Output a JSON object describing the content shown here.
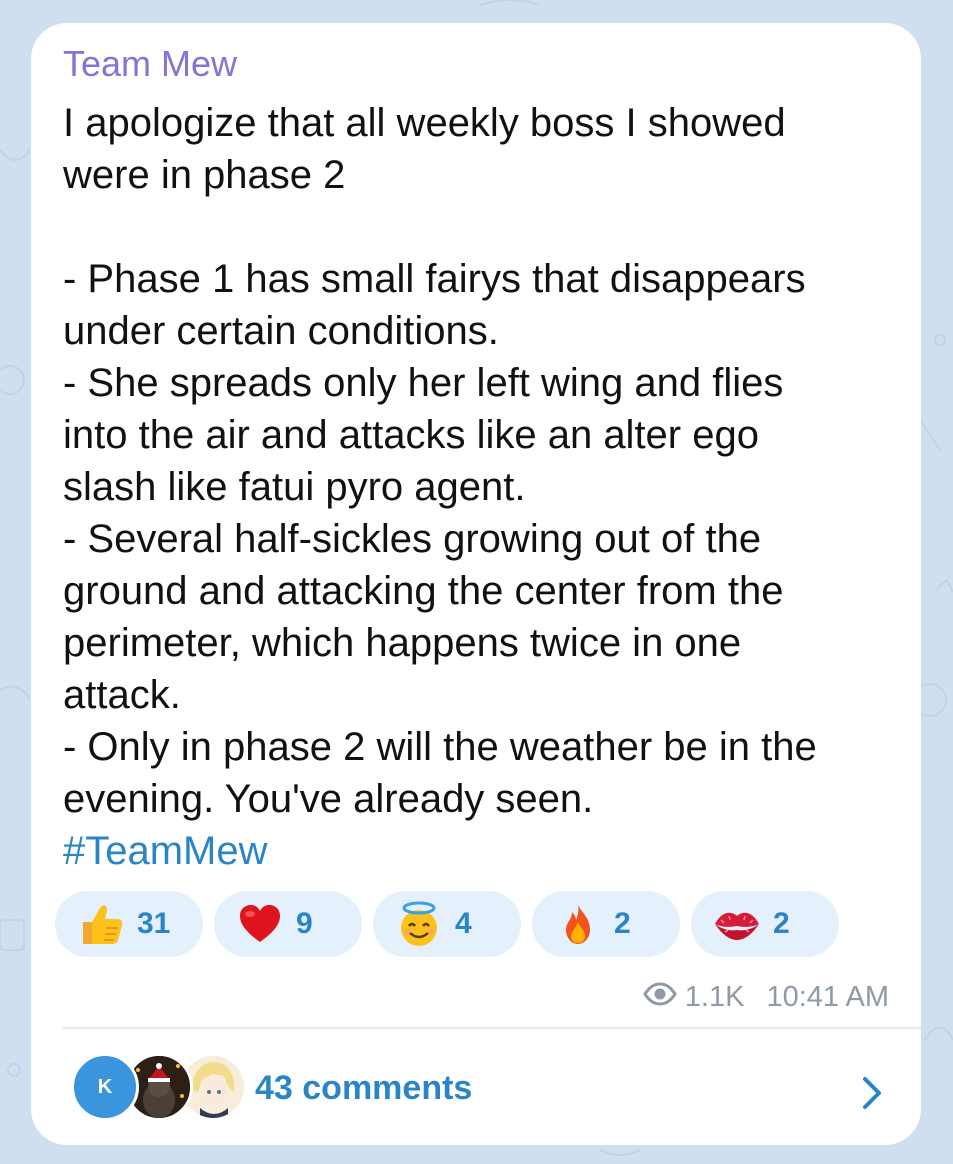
{
  "post": {
    "sender": "Team Mew",
    "message_lines": "I apologize that all weekly boss I showed\nwere in phase 2\n\n- Phase 1 has small fairys that disappears\nunder certain conditions.\n- She spreads only her left wing and flies\ninto the air and attacks like an alter ego\nslash like fatui pyro agent.\n- Several half-sickles growing out of the\nground and attacking the center from the\nperimeter, which happens twice in one\nattack.\n- Only in phase 2 will the weather be in the\nevening. You've already seen.",
    "hashtag": "#TeamMew",
    "views": "1.1K",
    "time": "10:41 AM"
  },
  "reactions": [
    {
      "icon": "thumbs-up-icon",
      "count": "31"
    },
    {
      "icon": "heart-icon",
      "count": "9"
    },
    {
      "icon": "smiling-halo-icon",
      "count": "4"
    },
    {
      "icon": "fire-icon",
      "count": "2"
    },
    {
      "icon": "kiss-mark-icon",
      "count": "2"
    }
  ],
  "comments": {
    "label": "43 comments",
    "avatar_initial": "K"
  },
  "colors": {
    "accent": "#2a85c7",
    "sender": "#8374d6",
    "background": "#cfdff0"
  }
}
